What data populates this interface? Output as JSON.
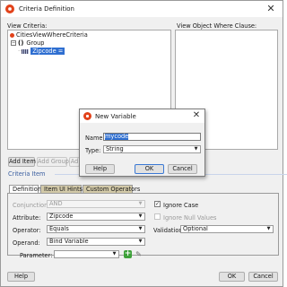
{
  "window": {
    "title": "Criteria Definition",
    "close_glyph": "✕",
    "icon": "oracle-jdeveloper-icon"
  },
  "labels": {
    "view_criteria": "View Criteria:",
    "view_object_where_clause": "View Object Where Clause:"
  },
  "tree": {
    "root": "CitiesViewWhereCriteria",
    "group_icon_glyph": "()",
    "group": "Group",
    "attribute_node": "Zipcode ="
  },
  "tree_buttons": {
    "add_item": "Add Item",
    "add_group": "Add Group",
    "add_truncated": "Ad"
  },
  "criteria_item": {
    "section_title": "Criteria Item",
    "tabs": [
      "Definition",
      "Item UI Hints",
      "Custom Operators"
    ],
    "active_tab": 0,
    "fields": {
      "conjunction_label": "Conjunction:",
      "conjunction_value": "AND",
      "attribute_label": "Attribute:",
      "attribute_value": "Zipcode",
      "operator_label": "Operator:",
      "operator_value": "Equals",
      "operand_label": "Operand:",
      "operand_value": "Bind Variable",
      "parameter_label": "Parameter:",
      "parameter_value": "",
      "validation_label": "Validation:",
      "validation_value": "Optional"
    },
    "checkboxes": {
      "ignore_case_label": "Ignore Case",
      "ignore_case_checked": true,
      "ignore_null_label": "Ignore Null Values",
      "ignore_null_checked": false
    },
    "icons": {
      "plus_glyph": "+",
      "pencil_glyph": "✎"
    }
  },
  "footer": {
    "help": "Help",
    "ok": "OK",
    "cancel": "Cancel"
  },
  "dialog": {
    "title": "New Variable",
    "close_glyph": "✕",
    "name_label": "Name:",
    "name_value": "mycode",
    "type_label": "Type:",
    "type_value": "String",
    "help": "Help",
    "ok": "OK",
    "cancel": "Cancel"
  },
  "colors": {
    "selection": "#2f6fd1",
    "accent_icon": "#e2421a",
    "inactive_tab": "#d2c9a8",
    "add_icon": "#3ea13a"
  }
}
